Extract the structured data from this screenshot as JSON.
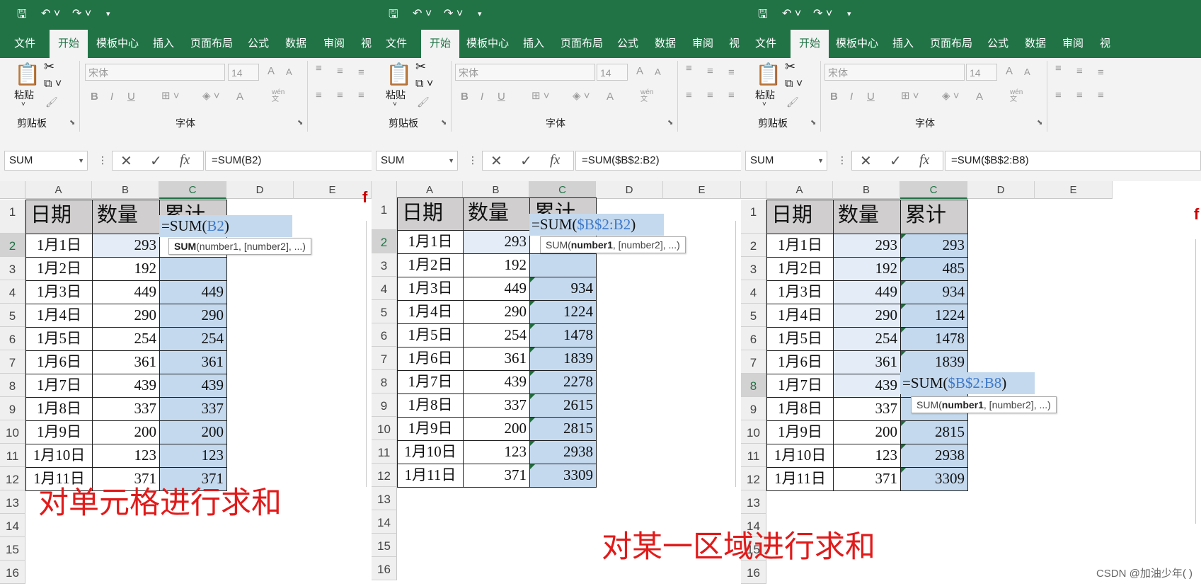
{
  "ribbon": {
    "tabs": [
      "文件",
      "开始",
      "模板中心",
      "插入",
      "页面布局",
      "公式",
      "数据",
      "审阅",
      "视"
    ],
    "clipboard": {
      "paste": "粘贴",
      "group": "剪贴板"
    },
    "font": {
      "name": "宋体",
      "size": "14",
      "group": "字体",
      "bold": "B",
      "italic": "I",
      "underline": "U",
      "grow": "A",
      "shrink": "A",
      "color": "A",
      "phonetic": "wén 文"
    }
  },
  "formula_bar": {
    "cancel": "✕",
    "enter": "✓",
    "fx": "fx"
  },
  "grid": {
    "columns": [
      "A",
      "B",
      "C",
      "D",
      "E"
    ],
    "rows": [
      "1",
      "2",
      "3",
      "4",
      "5",
      "6",
      "7",
      "8",
      "9",
      "10",
      "11",
      "12",
      "13",
      "14",
      "15",
      "16"
    ],
    "headers": [
      "日期",
      "数量",
      "累计"
    ],
    "dates": [
      "1月1日",
      "1月2日",
      "1月3日",
      "1月4日",
      "1月5日",
      "1月6日",
      "1月7日",
      "1月8日",
      "1月9日",
      "1月10日",
      "1月11日"
    ],
    "quantities": [
      "293",
      "192",
      "449",
      "290",
      "254",
      "361",
      "439",
      "337",
      "200",
      "123",
      "371"
    ],
    "cumulative": [
      "293",
      "485",
      "934",
      "1224",
      "1478",
      "1839",
      "2278",
      "2615",
      "2815",
      "2938",
      "3309"
    ]
  },
  "panels": [
    {
      "name_box": "SUM",
      "formula": "=SUM(B2)",
      "editor": {
        "prefix": "=SUM(",
        "ref": "B2",
        "suffix": ")"
      },
      "tooltip": {
        "func": "SUM",
        "args": "(number1, [number2], ...)"
      },
      "c_values": [
        "",
        "",
        "449",
        "290",
        "254",
        "361",
        "439",
        "337",
        "200",
        "123",
        "371"
      ],
      "caption": "对单元格进行求和"
    },
    {
      "name_box": "SUM",
      "formula": "=SUM($B$2:B2)",
      "editor": {
        "prefix": "=SUM(",
        "ref": "$B$2:B2",
        "suffix": ")"
      },
      "tooltip": {
        "pre": "SUM(",
        "arg": "number1",
        "rest": ", [number2], ...)"
      },
      "c_values": [
        "",
        "",
        "934",
        "1224",
        "1478",
        "1839",
        "2278",
        "2615",
        "2815",
        "2938",
        "3309"
      ],
      "caption": "对某一区域进行求和"
    },
    {
      "name_box": "SUM",
      "formula": "=SUM($B$2:B8)",
      "editor": {
        "prefix": "=SUM(",
        "ref": "$B$2:B8",
        "suffix": ")"
      },
      "tooltip": {
        "pre": "SUM(",
        "arg": "number1",
        "rest": ", [number2], ...)"
      },
      "c_values": [
        "293",
        "485",
        "934",
        "1224",
        "1478",
        "1839",
        "",
        "",
        "2815",
        "2938",
        "3309"
      ]
    }
  ],
  "watermark": "CSDN @加油少年(  )"
}
